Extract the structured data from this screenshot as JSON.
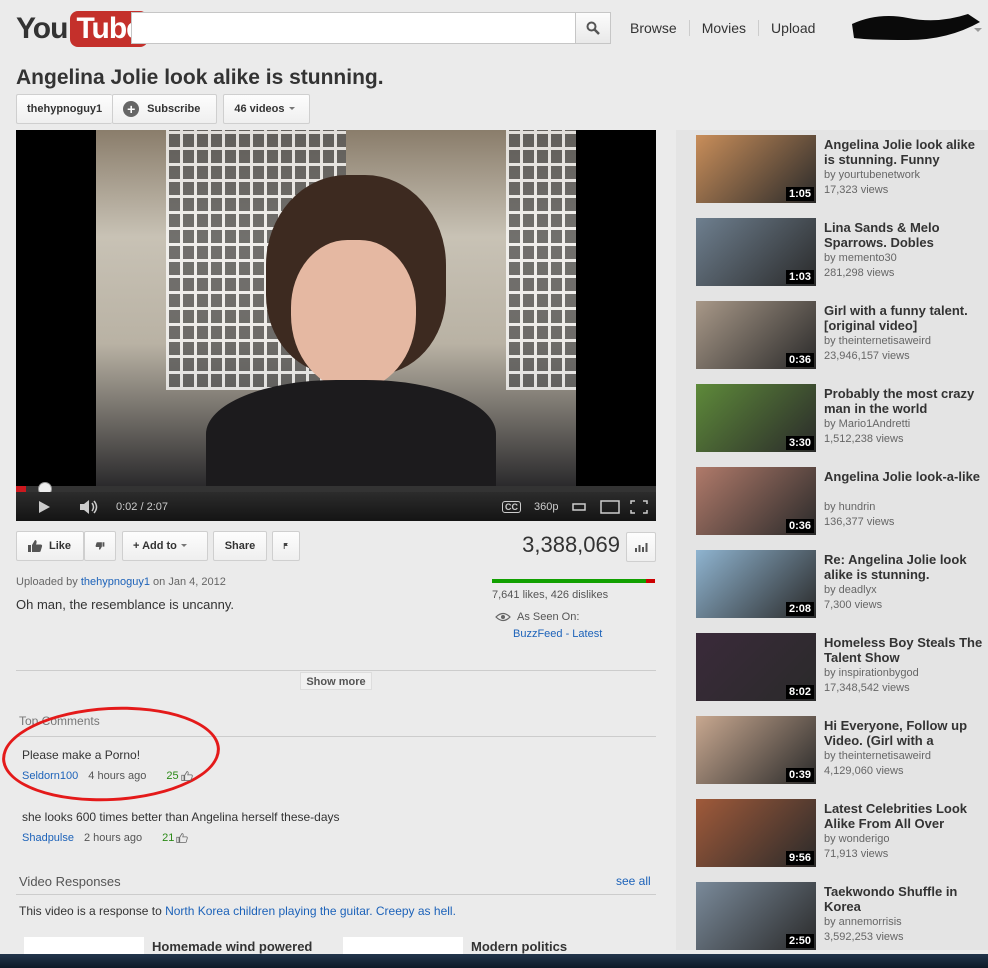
{
  "header": {
    "logo_you": "You",
    "logo_tube": "Tube",
    "search_placeholder": "",
    "nav": [
      "Browse",
      "Movies",
      "Upload"
    ]
  },
  "video": {
    "title": "Angelina Jolie look alike is stunning.",
    "channel": "thehypnoguy1",
    "subscribe": "Subscribe",
    "videos_count": "46 videos",
    "time": "0:02 / 2:07",
    "quality": "360p",
    "cc": "CC",
    "progress": 0.016
  },
  "actions": {
    "like": "Like",
    "add_to": "+ Add to",
    "share": "Share",
    "views": "3,388,069"
  },
  "info": {
    "uploaded_prefix": "Uploaded by",
    "uploader": "thehypnoguy1",
    "uploaded_suffix": "on Jan 4, 2012",
    "description": "Oh man, the resemblance is uncanny.",
    "likes_text": "7,641 likes, 426 dislikes",
    "like_ratio": 0.947,
    "seen_on": "As Seen On:",
    "seen_link": "BuzzFeed - Latest",
    "show_more": "Show more"
  },
  "comments": {
    "label": "Top Comments",
    "items": [
      {
        "text": "Please make a Porno!",
        "user": "Seldorn100",
        "time": "4 hours ago",
        "votes": "25"
      },
      {
        "text": "she looks 600 times better than Angelina herself these-days",
        "user": "Shadpulse",
        "time": "2 hours ago",
        "votes": "21"
      }
    ]
  },
  "responses": {
    "label": "Video Responses",
    "see_all": "see all",
    "text_prefix": "This video is a response to ",
    "link": "North Korea children playing the guitar. Creepy as hell.",
    "items": [
      "Homemade wind powered",
      "Modern politics"
    ]
  },
  "related": [
    {
      "title": "Angelina Jolie look alike is stunning. Funny",
      "by": "by yourtubenetwork",
      "views": "17,323 views",
      "duration": "1:05",
      "color": "#c98e5a"
    },
    {
      "title": "Lina Sands & Melo Sparrows. Dobles",
      "by": "by memento30",
      "views": "281,298 views",
      "duration": "1:03",
      "color": "#6e7f8f"
    },
    {
      "title": "Girl with a funny talent. [original video]",
      "by": "by theinternetisaweird",
      "views": "23,946,157 views",
      "duration": "0:36",
      "color": "#a89888"
    },
    {
      "title": "Probably the most crazy man in the world",
      "by": "by Mario1Andretti",
      "views": "1,512,238 views",
      "duration": "3:30",
      "color": "#5e8a3a"
    },
    {
      "title": "Angelina Jolie look-a-like",
      "by": "by hundrin",
      "views": "136,377 views",
      "duration": "0:36",
      "color": "#b07a6a"
    },
    {
      "title": "Re: Angelina Jolie look alike is stunning.",
      "by": "by deadlyx",
      "views": "7,300 views",
      "duration": "2:08",
      "color": "#8fb4d0"
    },
    {
      "title": "Homeless Boy Steals The Talent Show",
      "by": "by inspirationbygod",
      "views": "17,348,542 views",
      "duration": "8:02",
      "color": "#3a2a3a"
    },
    {
      "title": "Hi Everyone, Follow up Video. (Girl with a",
      "by": "by theinternetisaweird",
      "views": "4,129,060 views",
      "duration": "0:39",
      "color": "#c8a890"
    },
    {
      "title": "Latest Celebrities Look Alike From All Over",
      "by": "by wonderigo",
      "views": "71,913 views",
      "duration": "9:56",
      "color": "#a05a3a"
    },
    {
      "title": "Taekwondo Shuffle in Korea",
      "by": "by annemorrisis",
      "views": "3,592,253 views",
      "duration": "2:50",
      "color": "#7a8a9a"
    }
  ]
}
